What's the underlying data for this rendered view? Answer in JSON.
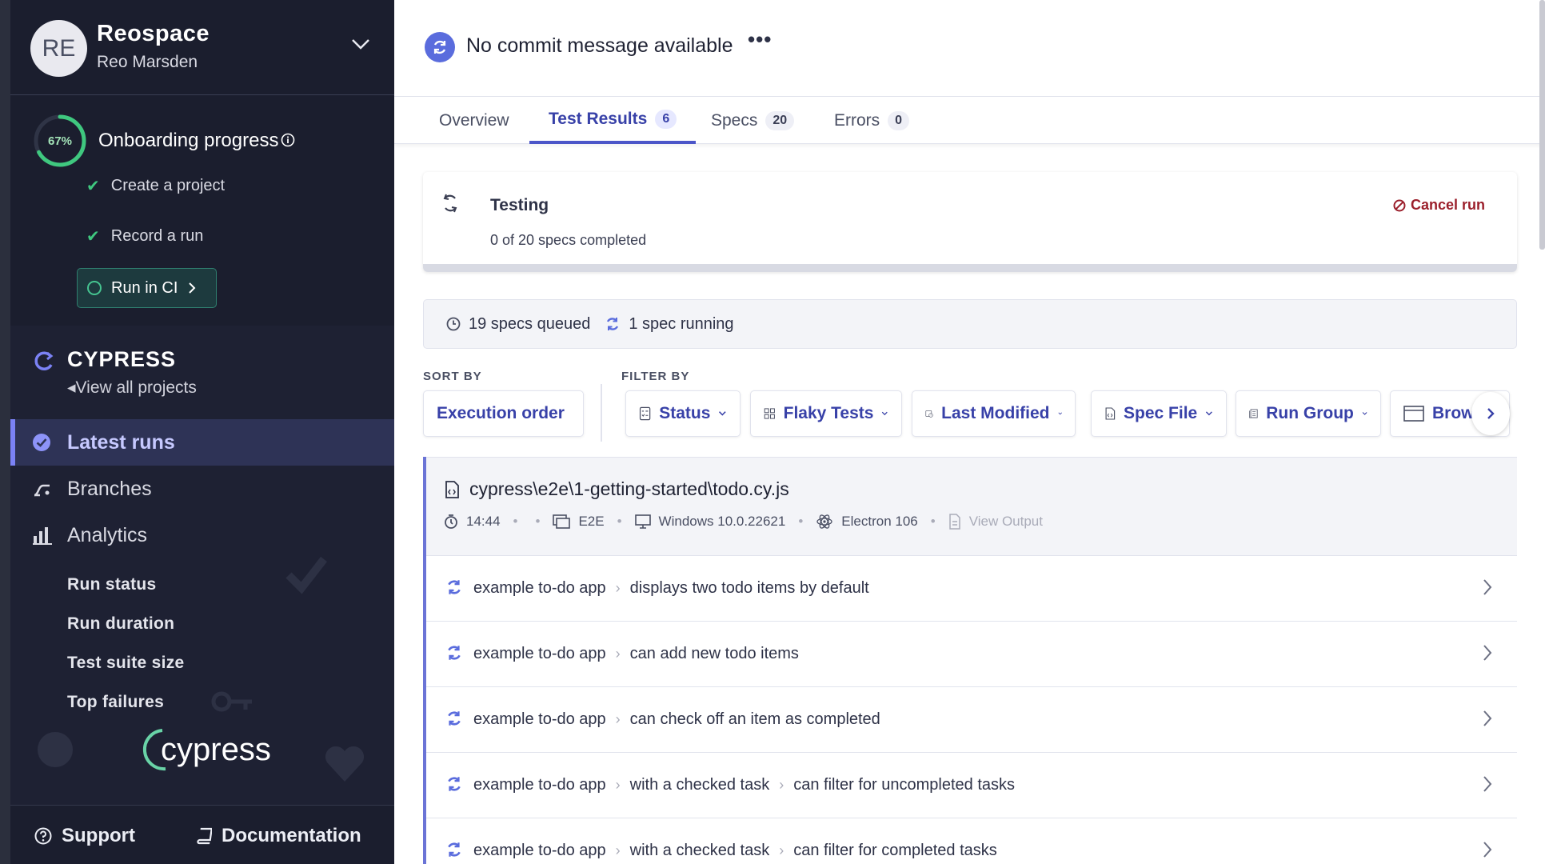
{
  "org": {
    "initials": "RE",
    "name": "Reospace",
    "user": "Reo Marsden"
  },
  "onboarding": {
    "progress_percent": 67,
    "progress_label": "67%",
    "title": "Onboarding progress",
    "items": [
      "Create a project",
      "Record a run"
    ],
    "cta_label": "Run in CI"
  },
  "project": {
    "name": "CYPRESS",
    "back_label": "View all projects"
  },
  "nav": {
    "latest_runs": "Latest runs",
    "branches": "Branches",
    "analytics": "Analytics",
    "sub_items": [
      "Run status",
      "Run duration",
      "Test suite size",
      "Top failures"
    ]
  },
  "logo_text": "cypress",
  "footer": {
    "support": "Support",
    "documentation": "Documentation"
  },
  "header": {
    "title": "No commit message available",
    "more": "•••"
  },
  "tabs": [
    {
      "label": "Overview",
      "count": ""
    },
    {
      "label": "Test Results",
      "count": "6"
    },
    {
      "label": "Specs",
      "count": "20"
    },
    {
      "label": "Errors",
      "count": "0"
    }
  ],
  "status": {
    "title": "Testing",
    "subtitle": "0 of 20 specs completed",
    "cancel_label": "Cancel run"
  },
  "queue": {
    "queued": "19 specs queued",
    "running": "1 spec running"
  },
  "sort": {
    "label": "SORT BY",
    "value": "Execution order"
  },
  "filter": {
    "label": "FILTER BY",
    "options": [
      "Status",
      "Flaky Tests",
      "Last Modified",
      "Spec File",
      "Run Group",
      "Brows"
    ]
  },
  "spec": {
    "file": "cypress\\e2e\\1-getting-started\\todo.cy.js",
    "duration": "14:44",
    "testing_type": "E2E",
    "os": "Windows 10.0.22621",
    "browser": "Electron 106",
    "view_output": "View Output"
  },
  "tests": [
    {
      "crumbs": [
        "example to-do app",
        "displays two todo items by default"
      ]
    },
    {
      "crumbs": [
        "example to-do app",
        "can add new todo items"
      ]
    },
    {
      "crumbs": [
        "example to-do app",
        "can check off an item as completed"
      ]
    },
    {
      "crumbs": [
        "example to-do app",
        "with a checked task",
        "can filter for uncompleted tasks"
      ]
    },
    {
      "crumbs": [
        "example to-do app",
        "with a checked task",
        "can filter for completed tasks"
      ]
    }
  ],
  "colors": {
    "sidebar_bg": "#1b1e2e",
    "accent": "#3841a8",
    "success": "#3fc87f",
    "danger": "#9b1f2b"
  }
}
